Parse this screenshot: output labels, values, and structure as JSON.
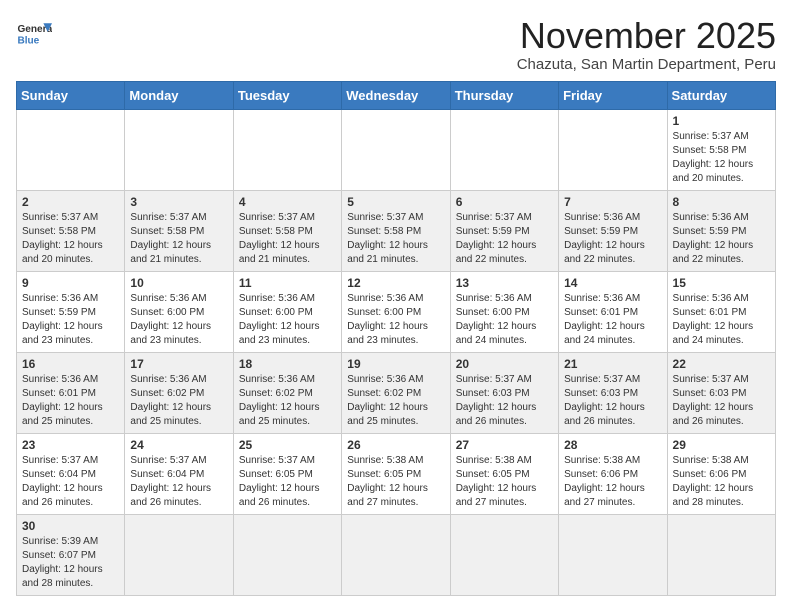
{
  "header": {
    "logo_general": "General",
    "logo_blue": "Blue",
    "month_title": "November 2025",
    "location": "Chazuta, San Martin Department, Peru"
  },
  "weekdays": [
    "Sunday",
    "Monday",
    "Tuesday",
    "Wednesday",
    "Thursday",
    "Friday",
    "Saturday"
  ],
  "weeks": [
    [
      {
        "day": "",
        "info": ""
      },
      {
        "day": "",
        "info": ""
      },
      {
        "day": "",
        "info": ""
      },
      {
        "day": "",
        "info": ""
      },
      {
        "day": "",
        "info": ""
      },
      {
        "day": "",
        "info": ""
      },
      {
        "day": "1",
        "info": "Sunrise: 5:37 AM\nSunset: 5:58 PM\nDaylight: 12 hours and 20 minutes."
      }
    ],
    [
      {
        "day": "2",
        "info": "Sunrise: 5:37 AM\nSunset: 5:58 PM\nDaylight: 12 hours and 20 minutes."
      },
      {
        "day": "3",
        "info": "Sunrise: 5:37 AM\nSunset: 5:58 PM\nDaylight: 12 hours and 21 minutes."
      },
      {
        "day": "4",
        "info": "Sunrise: 5:37 AM\nSunset: 5:58 PM\nDaylight: 12 hours and 21 minutes."
      },
      {
        "day": "5",
        "info": "Sunrise: 5:37 AM\nSunset: 5:58 PM\nDaylight: 12 hours and 21 minutes."
      },
      {
        "day": "6",
        "info": "Sunrise: 5:37 AM\nSunset: 5:59 PM\nDaylight: 12 hours and 22 minutes."
      },
      {
        "day": "7",
        "info": "Sunrise: 5:36 AM\nSunset: 5:59 PM\nDaylight: 12 hours and 22 minutes."
      },
      {
        "day": "8",
        "info": "Sunrise: 5:36 AM\nSunset: 5:59 PM\nDaylight: 12 hours and 22 minutes."
      }
    ],
    [
      {
        "day": "9",
        "info": "Sunrise: 5:36 AM\nSunset: 5:59 PM\nDaylight: 12 hours and 23 minutes."
      },
      {
        "day": "10",
        "info": "Sunrise: 5:36 AM\nSunset: 6:00 PM\nDaylight: 12 hours and 23 minutes."
      },
      {
        "day": "11",
        "info": "Sunrise: 5:36 AM\nSunset: 6:00 PM\nDaylight: 12 hours and 23 minutes."
      },
      {
        "day": "12",
        "info": "Sunrise: 5:36 AM\nSunset: 6:00 PM\nDaylight: 12 hours and 23 minutes."
      },
      {
        "day": "13",
        "info": "Sunrise: 5:36 AM\nSunset: 6:00 PM\nDaylight: 12 hours and 24 minutes."
      },
      {
        "day": "14",
        "info": "Sunrise: 5:36 AM\nSunset: 6:01 PM\nDaylight: 12 hours and 24 minutes."
      },
      {
        "day": "15",
        "info": "Sunrise: 5:36 AM\nSunset: 6:01 PM\nDaylight: 12 hours and 24 minutes."
      }
    ],
    [
      {
        "day": "16",
        "info": "Sunrise: 5:36 AM\nSunset: 6:01 PM\nDaylight: 12 hours and 25 minutes."
      },
      {
        "day": "17",
        "info": "Sunrise: 5:36 AM\nSunset: 6:02 PM\nDaylight: 12 hours and 25 minutes."
      },
      {
        "day": "18",
        "info": "Sunrise: 5:36 AM\nSunset: 6:02 PM\nDaylight: 12 hours and 25 minutes."
      },
      {
        "day": "19",
        "info": "Sunrise: 5:36 AM\nSunset: 6:02 PM\nDaylight: 12 hours and 25 minutes."
      },
      {
        "day": "20",
        "info": "Sunrise: 5:37 AM\nSunset: 6:03 PM\nDaylight: 12 hours and 26 minutes."
      },
      {
        "day": "21",
        "info": "Sunrise: 5:37 AM\nSunset: 6:03 PM\nDaylight: 12 hours and 26 minutes."
      },
      {
        "day": "22",
        "info": "Sunrise: 5:37 AM\nSunset: 6:03 PM\nDaylight: 12 hours and 26 minutes."
      }
    ],
    [
      {
        "day": "23",
        "info": "Sunrise: 5:37 AM\nSunset: 6:04 PM\nDaylight: 12 hours and 26 minutes."
      },
      {
        "day": "24",
        "info": "Sunrise: 5:37 AM\nSunset: 6:04 PM\nDaylight: 12 hours and 26 minutes."
      },
      {
        "day": "25",
        "info": "Sunrise: 5:37 AM\nSunset: 6:05 PM\nDaylight: 12 hours and 26 minutes."
      },
      {
        "day": "26",
        "info": "Sunrise: 5:38 AM\nSunset: 6:05 PM\nDaylight: 12 hours and 27 minutes."
      },
      {
        "day": "27",
        "info": "Sunrise: 5:38 AM\nSunset: 6:05 PM\nDaylight: 12 hours and 27 minutes."
      },
      {
        "day": "28",
        "info": "Sunrise: 5:38 AM\nSunset: 6:06 PM\nDaylight: 12 hours and 27 minutes."
      },
      {
        "day": "29",
        "info": "Sunrise: 5:38 AM\nSunset: 6:06 PM\nDaylight: 12 hours and 28 minutes."
      }
    ],
    [
      {
        "day": "30",
        "info": "Sunrise: 5:39 AM\nSunset: 6:07 PM\nDaylight: 12 hours and 28 minutes."
      },
      {
        "day": "",
        "info": ""
      },
      {
        "day": "",
        "info": ""
      },
      {
        "day": "",
        "info": ""
      },
      {
        "day": "",
        "info": ""
      },
      {
        "day": "",
        "info": ""
      },
      {
        "day": "",
        "info": ""
      }
    ]
  ]
}
